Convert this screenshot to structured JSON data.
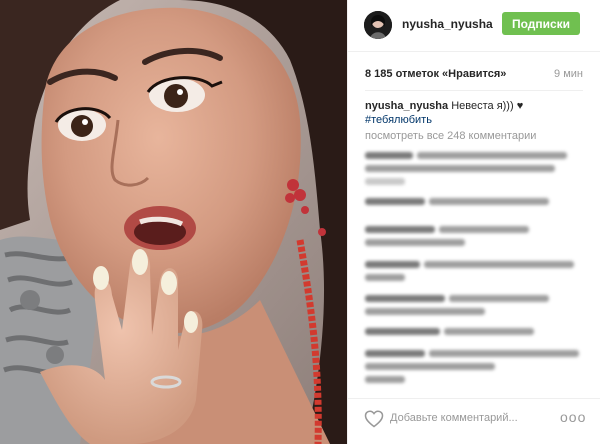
{
  "post": {
    "username": "nyusha_nyusha",
    "follow_label": "Подписки",
    "likes": "8 185 отметок «Нравится»",
    "time": "9 мин",
    "caption_user": "nyusha_nyusha",
    "caption_text": "Невеста я))) ♥",
    "caption_hashtag": "#тебялюбить",
    "view_all_comments": "посмотреть все 248 комментарии",
    "add_comment_placeholder": "Добавьте комментарий...",
    "more_label": "ooo"
  },
  "colors": {
    "follow_button": "#70c050",
    "hashtag": "#003569",
    "muted": "#999999"
  },
  "icons": {
    "like": "heart-icon",
    "options": "more-options-icon"
  }
}
